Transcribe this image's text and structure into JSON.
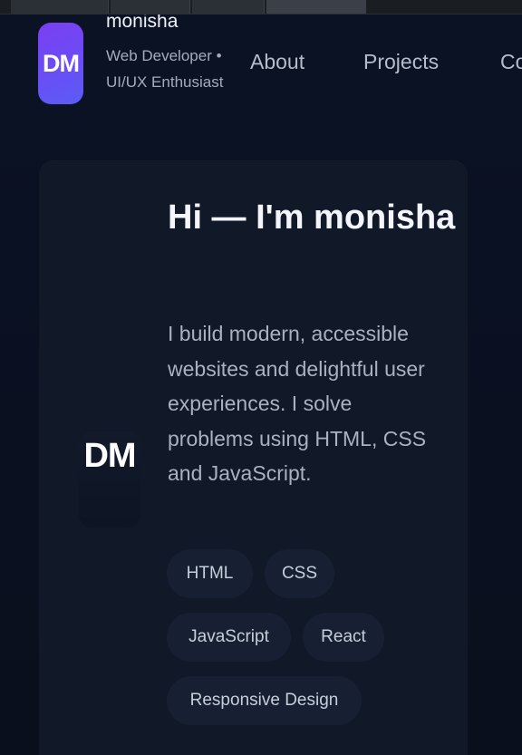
{
  "brand": {
    "logo_text": "DM",
    "name": "monisha",
    "tagline": "Web Developer • UI/UX Enthusiast"
  },
  "nav": {
    "items": [
      {
        "label": "About"
      },
      {
        "label": "Projects"
      },
      {
        "label": "Co"
      }
    ]
  },
  "hero": {
    "avatar_text": "DM",
    "title": "Hi — I'm monisha",
    "description": "I build modern, accessible websites and delightful user experiences. I solve problems using HTML, CSS and JavaScript.",
    "skills": [
      "HTML",
      "CSS",
      "JavaScript",
      "React",
      "Responsive Design"
    ]
  },
  "colors": {
    "background": "#0b1122",
    "card": "#111827",
    "accent_start": "#7b3ff2",
    "accent_end": "#5b5cf5",
    "chip": "#172033"
  }
}
